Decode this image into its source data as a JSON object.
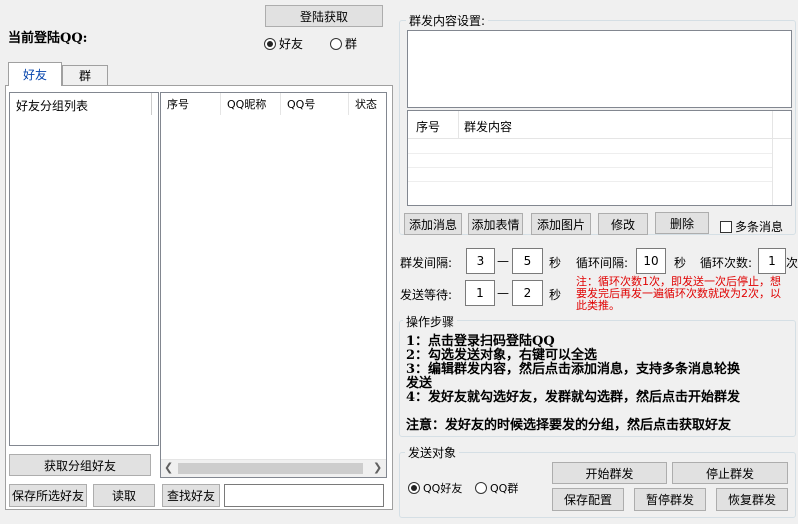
{
  "top": {
    "current_qq_label": "当前登陆QQ:",
    "login_button": "登陆获取",
    "radio_friend": "好友",
    "radio_group": "群"
  },
  "tabs": [
    {
      "label": "好友"
    },
    {
      "label": "群"
    }
  ],
  "friend_group_list": {
    "header": "好友分组列表"
  },
  "friend_table": {
    "columns": [
      "序号",
      "QQ昵称",
      "QQ号",
      "状态"
    ]
  },
  "left_buttons": {
    "get_group_friends": "获取分组好友",
    "save_selected": "保存所选好友",
    "read": "读取",
    "find_friend": "查找好友",
    "find_input_value": ""
  },
  "content_settings": {
    "title": "群发内容设置:",
    "table_columns": [
      "序号",
      "群发内容"
    ],
    "buttons": [
      "添加消息",
      "添加表情",
      "添加图片",
      "修改",
      "删除"
    ],
    "multi_msg_label": "多条消息"
  },
  "timing": {
    "interval_label": "群发间隔:",
    "interval_min": "3",
    "interval_max": "5",
    "dash": "—",
    "sec": "秒",
    "loop_interval_label": "循环间隔:",
    "loop_interval": "10",
    "loop_count_label": "循环次数:",
    "loop_count": "1",
    "times": "次",
    "wait_label": "发送等待:",
    "wait_min": "1",
    "wait_max": "2",
    "note_line1": "注：循环次数1次，即发送一次后停止，想",
    "note_line2": "要发完后再发一遍循环次数就改为2次，以",
    "note_line3": "此类推。"
  },
  "steps": {
    "title": "操作步骤",
    "step1": "1：点击登录扫码登陆QQ",
    "step2": "2：勾选发送对象，右键可以全选",
    "step3a": "3：编辑群发内容，然后点击添加消息，支持多条消息轮换",
    "step3b": "发送",
    "step4": "4：发好友就勾选好友，发群就勾选群，然后点击开始群发",
    "note": "注意：发好友的时候选择要发的分组，然后点击获取好友"
  },
  "send_target": {
    "title": "发送对象",
    "radio_friend": "QQ好友",
    "radio_group": "QQ群",
    "start": "开始群发",
    "stop": "停止群发",
    "save_config": "保存配置",
    "pause": "暂停群发",
    "resume": "恢复群发"
  }
}
